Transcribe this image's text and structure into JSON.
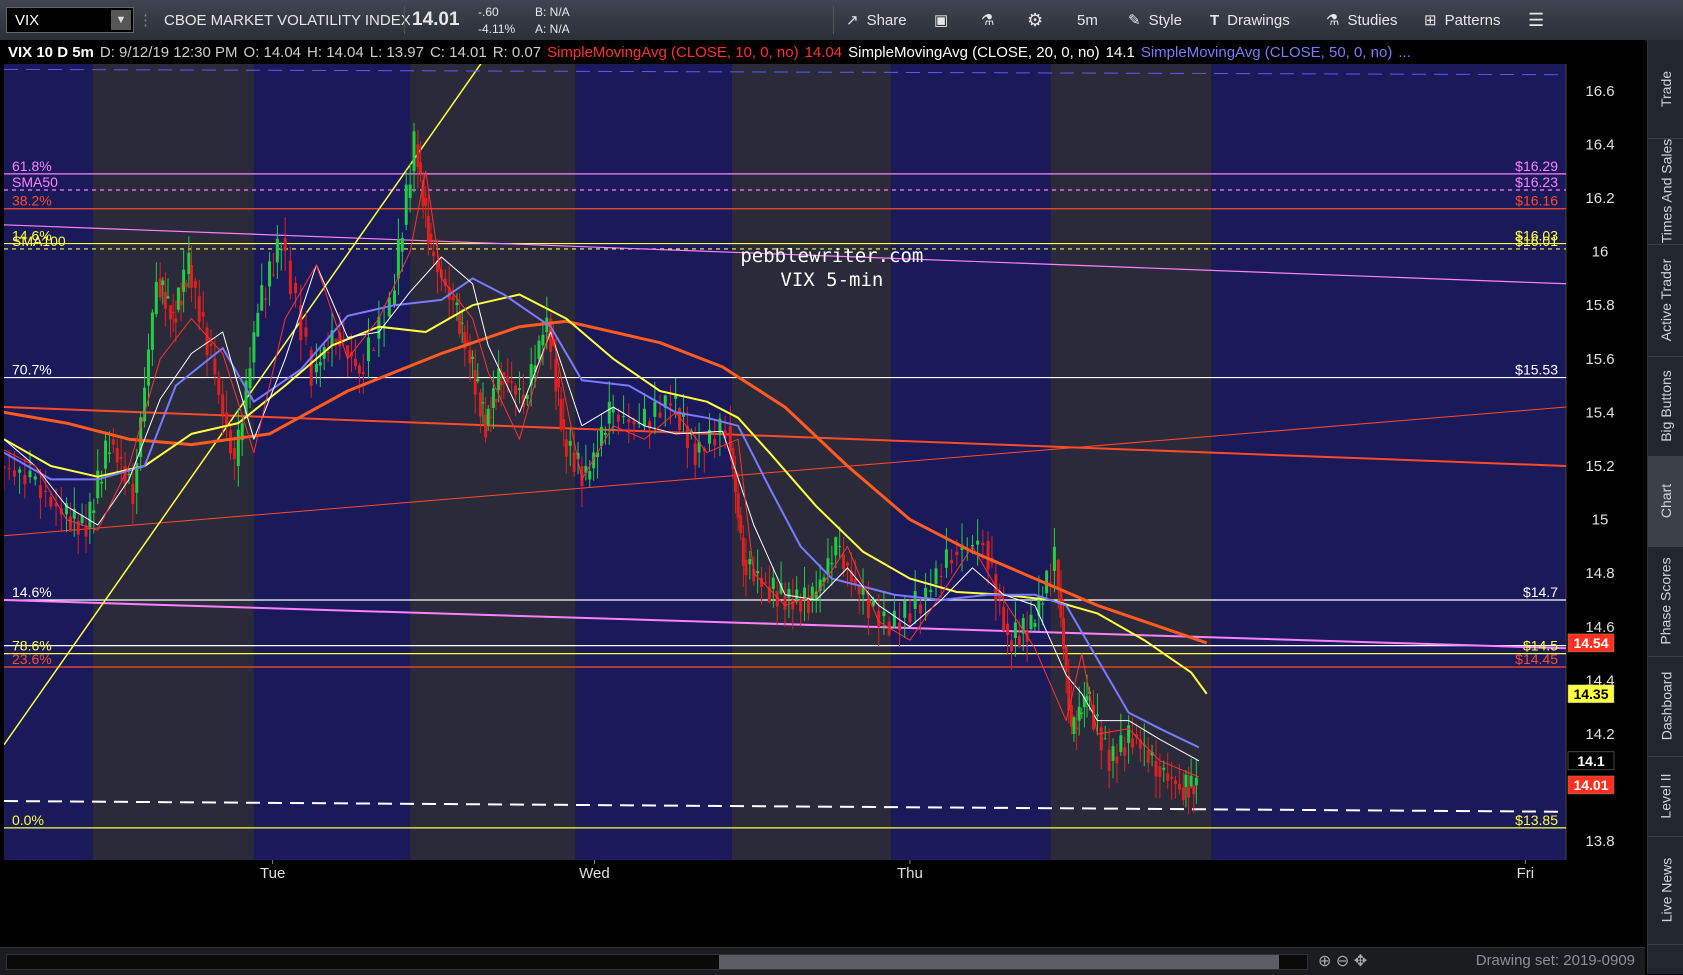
{
  "toolbar": {
    "symbol": "VIX",
    "name": "CBOE MARKET VOLATILITY INDEX",
    "last": "14.01",
    "change": "-.60",
    "change_pct": "-4.11%",
    "bid": "B: N/A",
    "ask": "A: N/A",
    "share": "Share",
    "timeframe": "5m",
    "style": "Style",
    "drawings": "Drawings",
    "studies": "Studies",
    "patterns": "Patterns"
  },
  "infobar": {
    "title": "VIX 10 D 5m",
    "date": "D: 9/12/19 12:30 PM",
    "open": "O: 14.04",
    "high": "H: 14.04",
    "low": "L: 13.97",
    "close": "C: 14.01",
    "range": "R: 0.07",
    "sma10_label": "SimpleMovingAvg (CLOSE, 10, 0, no)",
    "sma10_value": "14.04",
    "sma20_label": "SimpleMovingAvg (CLOSE, 20, 0, no)",
    "sma20_value": "14.1",
    "sma50_label": "SimpleMovingAvg (CLOSE, 50, 0, no)",
    "sma50_value": "..."
  },
  "sidebar": [
    "Trade",
    "Times And Sales",
    "Active Trader",
    "Big Buttons",
    "Chart",
    "Phase Scores",
    "Dashboard",
    "Level II",
    "Live News"
  ],
  "bottom": {
    "drawing_set": "Drawing set: 2019-0909"
  },
  "colors": {
    "bg": "#000000",
    "band_dark": "#1a1a5a",
    "band_light": "#2a2a3a",
    "sma10": "#ff3030",
    "sma20": "#ffffff",
    "sma50": "#7a7aff",
    "sma100": "#ffff40",
    "sma200": "#ff5a1f",
    "fib_pink": "#ff80ff",
    "fib_white": "#ffffff",
    "fib_yellow": "#ffff40",
    "fib_red": "#ff4a2a"
  },
  "chart_data": {
    "type": "candlestick",
    "watermark": [
      "pebblewriter.com",
      "VIX 5-min"
    ],
    "y_axis": {
      "ticks": [
        13.8,
        14,
        14.2,
        14.4,
        14.6,
        14.8,
        15,
        15.2,
        15.4,
        15.6,
        15.8,
        16,
        16.2,
        16.4,
        16.6
      ],
      "ylim": [
        13.73,
        16.7
      ]
    },
    "x_axis": {
      "labels": [
        {
          "text": "Tue",
          "pos": 0.172
        },
        {
          "text": "Wed",
          "pos": 0.378
        },
        {
          "text": "Thu",
          "pos": 0.58
        },
        {
          "text": "Fri",
          "pos": 0.974
        }
      ]
    },
    "session_bands": [
      [
        0,
        0.057,
        "dark"
      ],
      [
        0.057,
        0.16,
        "light"
      ],
      [
        0.16,
        0.26,
        "dark"
      ],
      [
        0.26,
        0.366,
        "light"
      ],
      [
        0.366,
        0.466,
        "dark"
      ],
      [
        0.466,
        0.568,
        "light"
      ],
      [
        0.568,
        0.67,
        "dark"
      ],
      [
        0.67,
        0.773,
        "light"
      ],
      [
        0.773,
        1,
        "dark"
      ]
    ],
    "horizontal_levels": [
      {
        "value": 16.29,
        "left": "61.8%",
        "right": "$16.29",
        "color": "#ff80ff",
        "dash": false
      },
      {
        "value": 16.23,
        "left": "SMA50",
        "right": "$16.23",
        "color": "#ff80ff",
        "dash": true
      },
      {
        "value": 16.16,
        "left": "38.2%",
        "right": "$16.16",
        "color": "#ff4a2a",
        "dash": false
      },
      {
        "value": 16.03,
        "left": "14.6%",
        "right": "$16.03",
        "color": "#ffff40",
        "dash": false
      },
      {
        "value": 16.01,
        "left": "SMA100",
        "right": "$16.01",
        "color": "#ffff40",
        "dash": true
      },
      {
        "value": 15.53,
        "left": "70.7%",
        "right": "$15.53",
        "color": "#ffffff",
        "dash": false
      },
      {
        "value": 14.7,
        "left": "14.6%",
        "right": "$14.7",
        "color": "#ffffff",
        "dash": false
      },
      {
        "value": 14.5,
        "left": "78.6%",
        "right": "$14.5",
        "color": "#ffff40",
        "dash": false
      },
      {
        "value": 14.53,
        "left": "",
        "right": "",
        "color": "#ffffff",
        "dash": false
      },
      {
        "value": 14.45,
        "left": "23.6%",
        "right": "$14.45",
        "color": "#ff4a2a",
        "dash": false
      },
      {
        "value": 13.85,
        "left": "0.0%",
        "right": "$13.85",
        "color": "#ffff40",
        "dash": false
      }
    ],
    "trendlines": [
      {
        "x1": 0,
        "y1": 16.1,
        "x2": 1,
        "y2": 15.88,
        "color": "#ff80ff",
        "width": 1.2
      },
      {
        "x1": 0,
        "y1": 14.7,
        "x2": 1,
        "y2": 14.52,
        "color": "#ff80ff",
        "width": 2
      },
      {
        "x1": 0,
        "y1": 15.42,
        "x2": 1,
        "y2": 15.2,
        "color": "#ff4a2a",
        "width": 2
      },
      {
        "x1": 0,
        "y1": 14.94,
        "x2": 1,
        "y2": 15.42,
        "color": "#ff4a2a",
        "width": 1
      },
      {
        "x1": 0,
        "y1": 14.16,
        "x2": 0.31,
        "y2": 16.74,
        "color": "#ffff40",
        "width": 1.5
      },
      {
        "x1": 0,
        "y1": 13.95,
        "x2": 1,
        "y2": 13.91,
        "color": "#ffffff",
        "width": 2,
        "dash": true
      },
      {
        "x1": 0,
        "y1": 16.68,
        "x2": 1,
        "y2": 16.66,
        "color": "#5a5aff",
        "width": 1,
        "dash": true
      }
    ],
    "price_labels": [
      {
        "value": 14.54,
        "text": "14.54",
        "bg": "#ff3020",
        "fg": "#ffffff"
      },
      {
        "value": 14.35,
        "text": "14.35",
        "bg": "#ffff40",
        "fg": "#000000"
      },
      {
        "value": 14.1,
        "text": "14.1",
        "bg": "#000000",
        "fg": "#ffffff"
      },
      {
        "value": 14.01,
        "text": "14.01",
        "bg": "#ff3020",
        "fg": "#ffffff"
      }
    ],
    "series": [
      {
        "name": "SMA200",
        "color": "#ff5a1f",
        "width": 3,
        "points": [
          [
            0,
            15.4
          ],
          [
            0.04,
            15.36
          ],
          [
            0.08,
            15.3
          ],
          [
            0.12,
            15.28
          ],
          [
            0.17,
            15.32
          ],
          [
            0.22,
            15.48
          ],
          [
            0.28,
            15.62
          ],
          [
            0.33,
            15.72
          ],
          [
            0.36,
            15.74
          ],
          [
            0.42,
            15.66
          ],
          [
            0.46,
            15.57
          ],
          [
            0.5,
            15.42
          ],
          [
            0.54,
            15.2
          ],
          [
            0.58,
            15.0
          ],
          [
            0.62,
            14.88
          ],
          [
            0.66,
            14.78
          ],
          [
            0.7,
            14.68
          ],
          [
            0.74,
            14.6
          ],
          [
            0.77,
            14.54
          ]
        ]
      },
      {
        "name": "SMA100",
        "color": "#ffff40",
        "width": 2,
        "points": [
          [
            0,
            15.3
          ],
          [
            0.03,
            15.2
          ],
          [
            0.06,
            15.16
          ],
          [
            0.09,
            15.2
          ],
          [
            0.12,
            15.32
          ],
          [
            0.15,
            15.36
          ],
          [
            0.18,
            15.5
          ],
          [
            0.21,
            15.65
          ],
          [
            0.24,
            15.72
          ],
          [
            0.27,
            15.7
          ],
          [
            0.3,
            15.8
          ],
          [
            0.33,
            15.84
          ],
          [
            0.36,
            15.75
          ],
          [
            0.39,
            15.6
          ],
          [
            0.42,
            15.48
          ],
          [
            0.45,
            15.44
          ],
          [
            0.47,
            15.38
          ],
          [
            0.49,
            15.25
          ],
          [
            0.52,
            15.05
          ],
          [
            0.55,
            14.88
          ],
          [
            0.58,
            14.78
          ],
          [
            0.61,
            14.73
          ],
          [
            0.64,
            14.72
          ],
          [
            0.67,
            14.7
          ],
          [
            0.7,
            14.65
          ],
          [
            0.73,
            14.55
          ],
          [
            0.76,
            14.43
          ],
          [
            0.77,
            14.35
          ]
        ]
      },
      {
        "name": "SMA50",
        "color": "#7a7aff",
        "width": 2,
        "points": [
          [
            0,
            15.25
          ],
          [
            0.03,
            15.15
          ],
          [
            0.06,
            15.15
          ],
          [
            0.09,
            15.2
          ],
          [
            0.11,
            15.5
          ],
          [
            0.14,
            15.64
          ],
          [
            0.16,
            15.44
          ],
          [
            0.19,
            15.56
          ],
          [
            0.22,
            15.76
          ],
          [
            0.25,
            15.8
          ],
          [
            0.28,
            15.82
          ],
          [
            0.3,
            15.9
          ],
          [
            0.32,
            15.84
          ],
          [
            0.35,
            15.72
          ],
          [
            0.37,
            15.52
          ],
          [
            0.4,
            15.5
          ],
          [
            0.43,
            15.4
          ],
          [
            0.45,
            15.38
          ],
          [
            0.47,
            15.35
          ],
          [
            0.49,
            15.12
          ],
          [
            0.51,
            14.9
          ],
          [
            0.53,
            14.78
          ],
          [
            0.55,
            14.75
          ],
          [
            0.57,
            14.72
          ],
          [
            0.6,
            14.7
          ],
          [
            0.63,
            14.72
          ],
          [
            0.66,
            14.72
          ],
          [
            0.68,
            14.68
          ],
          [
            0.7,
            14.48
          ],
          [
            0.72,
            14.28
          ],
          [
            0.74,
            14.22
          ],
          [
            0.765,
            14.15
          ]
        ]
      },
      {
        "name": "SMA20",
        "color": "#ffffff",
        "width": 1,
        "points": [
          [
            0,
            15.3
          ],
          [
            0.02,
            15.2
          ],
          [
            0.04,
            15.05
          ],
          [
            0.06,
            14.98
          ],
          [
            0.08,
            15.15
          ],
          [
            0.1,
            15.45
          ],
          [
            0.12,
            15.62
          ],
          [
            0.14,
            15.7
          ],
          [
            0.16,
            15.3
          ],
          [
            0.18,
            15.6
          ],
          [
            0.2,
            15.95
          ],
          [
            0.22,
            15.68
          ],
          [
            0.24,
            15.7
          ],
          [
            0.26,
            15.85
          ],
          [
            0.28,
            15.98
          ],
          [
            0.3,
            15.88
          ],
          [
            0.31,
            15.65
          ],
          [
            0.33,
            15.4
          ],
          [
            0.35,
            15.7
          ],
          [
            0.37,
            15.35
          ],
          [
            0.39,
            15.42
          ],
          [
            0.41,
            15.35
          ],
          [
            0.43,
            15.32
          ],
          [
            0.46,
            15.33
          ],
          [
            0.48,
            14.98
          ],
          [
            0.5,
            14.72
          ],
          [
            0.52,
            14.7
          ],
          [
            0.54,
            14.82
          ],
          [
            0.56,
            14.68
          ],
          [
            0.58,
            14.6
          ],
          [
            0.6,
            14.7
          ],
          [
            0.62,
            14.82
          ],
          [
            0.64,
            14.72
          ],
          [
            0.66,
            14.68
          ],
          [
            0.68,
            14.42
          ],
          [
            0.69,
            14.35
          ],
          [
            0.7,
            14.25
          ],
          [
            0.72,
            14.25
          ],
          [
            0.74,
            14.18
          ],
          [
            0.765,
            14.1
          ]
        ]
      },
      {
        "name": "SMA10",
        "color": "#ff3030",
        "width": 1,
        "points": [
          [
            0,
            15.26
          ],
          [
            0.02,
            15.2
          ],
          [
            0.04,
            15.0
          ],
          [
            0.06,
            14.96
          ],
          [
            0.08,
            15.2
          ],
          [
            0.1,
            15.6
          ],
          [
            0.12,
            15.75
          ],
          [
            0.14,
            15.62
          ],
          [
            0.16,
            15.25
          ],
          [
            0.18,
            15.75
          ],
          [
            0.2,
            15.95
          ],
          [
            0.22,
            15.6
          ],
          [
            0.24,
            15.75
          ],
          [
            0.26,
            16.0
          ],
          [
            0.27,
            16.3
          ],
          [
            0.28,
            15.9
          ],
          [
            0.3,
            15.75
          ],
          [
            0.31,
            15.55
          ],
          [
            0.33,
            15.3
          ],
          [
            0.35,
            15.72
          ],
          [
            0.37,
            15.15
          ],
          [
            0.39,
            15.35
          ],
          [
            0.41,
            15.3
          ],
          [
            0.43,
            15.4
          ],
          [
            0.45,
            15.25
          ],
          [
            0.47,
            15.3
          ],
          [
            0.48,
            14.8
          ],
          [
            0.5,
            14.68
          ],
          [
            0.52,
            14.72
          ],
          [
            0.54,
            14.9
          ],
          [
            0.56,
            14.62
          ],
          [
            0.58,
            14.55
          ],
          [
            0.6,
            14.72
          ],
          [
            0.62,
            14.9
          ],
          [
            0.64,
            14.7
          ],
          [
            0.66,
            14.52
          ],
          [
            0.68,
            14.25
          ],
          [
            0.69,
            14.5
          ],
          [
            0.7,
            14.2
          ],
          [
            0.72,
            14.22
          ],
          [
            0.74,
            14.1
          ],
          [
            0.765,
            14.04
          ]
        ]
      },
      {
        "name": "Price",
        "color": "#22cc44",
        "width": 1,
        "points": [
          [
            0,
            15.2
          ],
          [
            0.02,
            15.15
          ],
          [
            0.04,
            15.02
          ],
          [
            0.055,
            14.97
          ],
          [
            0.07,
            15.3
          ],
          [
            0.085,
            15.1
          ],
          [
            0.1,
            15.9
          ],
          [
            0.11,
            15.75
          ],
          [
            0.12,
            15.95
          ],
          [
            0.135,
            15.6
          ],
          [
            0.15,
            15.2
          ],
          [
            0.165,
            15.78
          ],
          [
            0.18,
            16.05
          ],
          [
            0.2,
            15.55
          ],
          [
            0.215,
            15.7
          ],
          [
            0.23,
            15.55
          ],
          [
            0.25,
            15.8
          ],
          [
            0.265,
            16.4
          ],
          [
            0.275,
            16.0
          ],
          [
            0.29,
            15.8
          ],
          [
            0.3,
            15.6
          ],
          [
            0.31,
            15.35
          ],
          [
            0.32,
            15.55
          ],
          [
            0.335,
            15.45
          ],
          [
            0.35,
            15.75
          ],
          [
            0.36,
            15.3
          ],
          [
            0.375,
            15.15
          ],
          [
            0.39,
            15.4
          ],
          [
            0.41,
            15.35
          ],
          [
            0.43,
            15.45
          ],
          [
            0.445,
            15.25
          ],
          [
            0.465,
            15.35
          ],
          [
            0.475,
            14.85
          ],
          [
            0.49,
            14.75
          ],
          [
            0.505,
            14.7
          ],
          [
            0.52,
            14.7
          ],
          [
            0.535,
            14.9
          ],
          [
            0.55,
            14.72
          ],
          [
            0.57,
            14.6
          ],
          [
            0.59,
            14.7
          ],
          [
            0.61,
            14.88
          ],
          [
            0.63,
            14.92
          ],
          [
            0.645,
            14.55
          ],
          [
            0.66,
            14.6
          ],
          [
            0.675,
            14.85
          ],
          [
            0.685,
            14.2
          ],
          [
            0.695,
            14.35
          ],
          [
            0.71,
            14.1
          ],
          [
            0.725,
            14.2
          ],
          [
            0.74,
            14.08
          ],
          [
            0.755,
            14.0
          ],
          [
            0.765,
            14.01
          ]
        ]
      }
    ]
  }
}
